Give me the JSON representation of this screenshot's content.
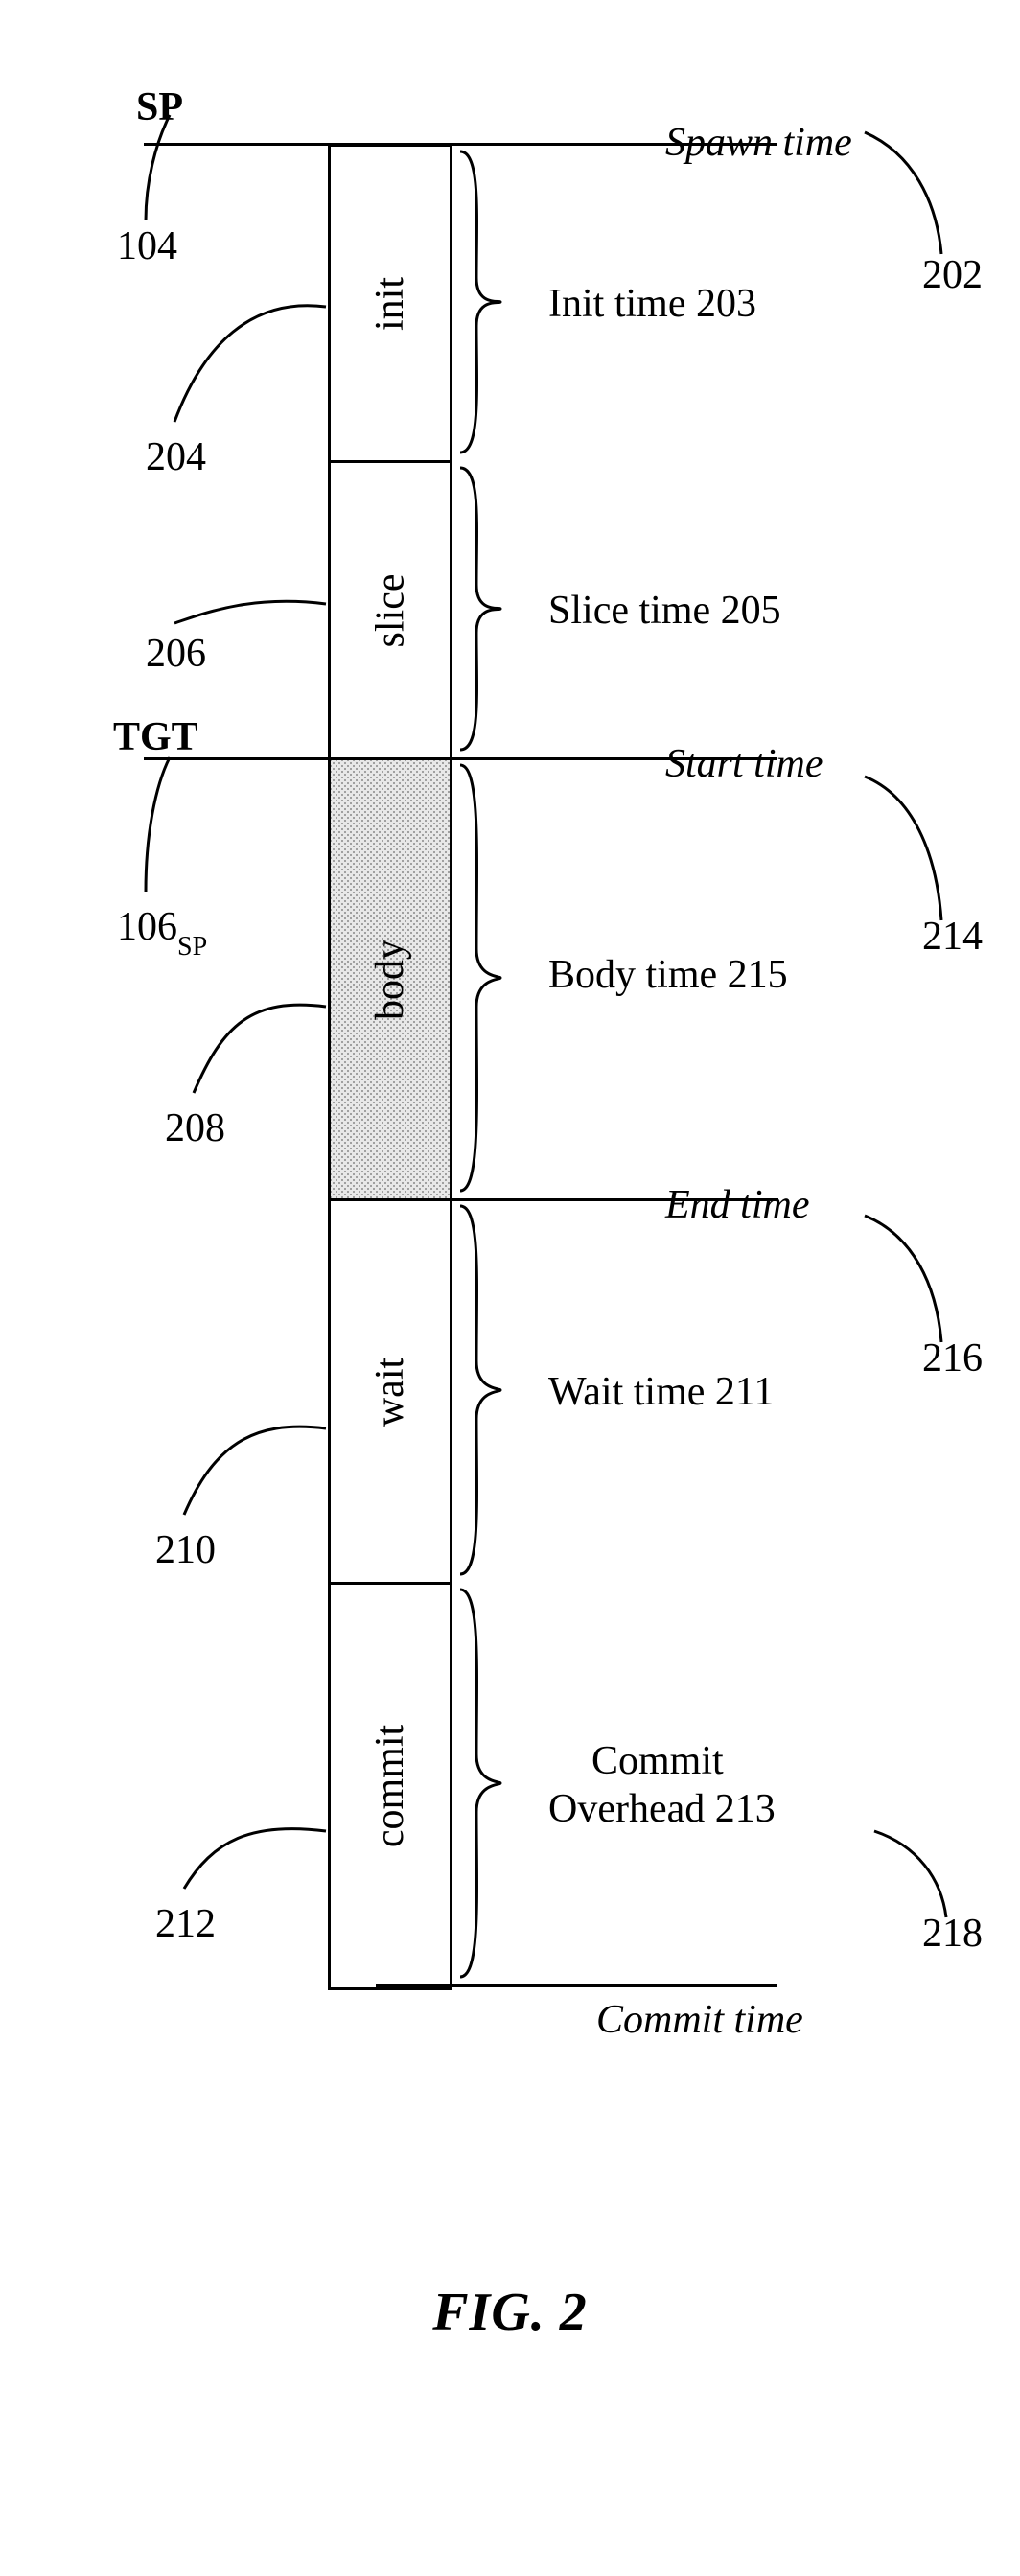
{
  "figure": {
    "caption": "FIG. 2"
  },
  "markers": {
    "sp": {
      "label": "SP",
      "ref": "104"
    },
    "tgt": {
      "label": "TGT",
      "ref": "106",
      "sub": "SP"
    }
  },
  "blocks": {
    "init": {
      "name": "init",
      "ref": "204"
    },
    "slice": {
      "name": "slice",
      "ref": "206"
    },
    "body": {
      "name": "body",
      "ref": "208"
    },
    "wait": {
      "name": "wait",
      "ref": "210"
    },
    "commit": {
      "name": "commit",
      "ref": "212"
    }
  },
  "times": {
    "spawn": {
      "label": "Spawn time",
      "ref": "202"
    },
    "init": {
      "label": "Init time 203"
    },
    "slice": {
      "label": "Slice time 205"
    },
    "start": {
      "label": "Start time",
      "ref": "214"
    },
    "body": {
      "label": "Body time 215"
    },
    "end_": {
      "label": "End time",
      "ref": "216"
    },
    "wait": {
      "label": "Wait time 211"
    },
    "commit_ovh_l1": {
      "label": "Commit"
    },
    "commit_ovh_l2": {
      "label": "Overhead 213"
    },
    "commit_ref": {
      "ref": "218"
    },
    "commit": {
      "label": "Commit time"
    }
  }
}
